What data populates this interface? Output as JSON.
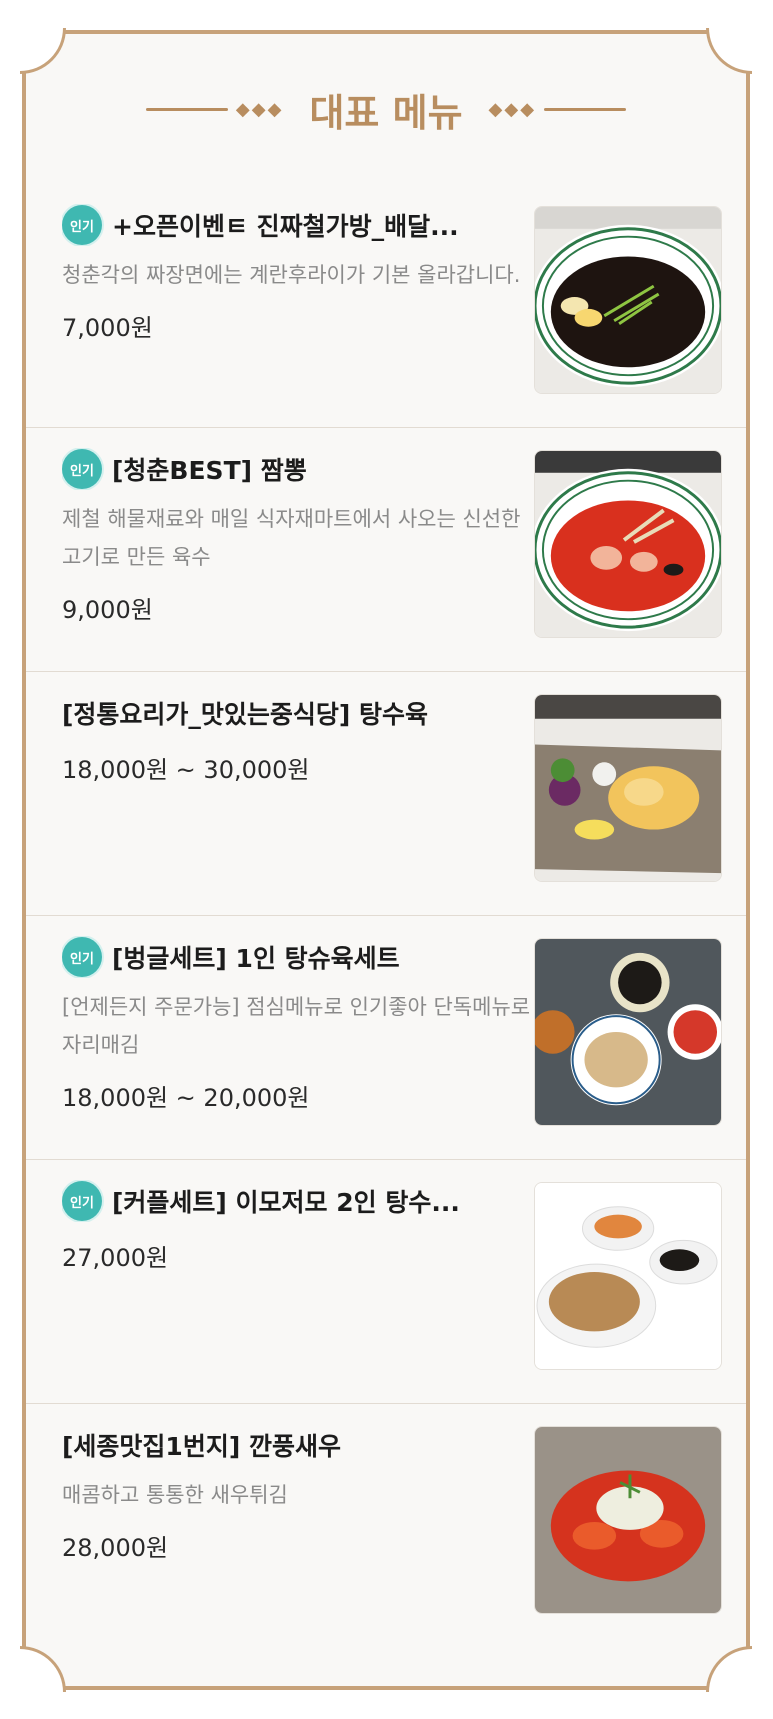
{
  "header": {
    "title": "대표 메뉴",
    "diamonds": "◆◆◆"
  },
  "menu": [
    {
      "badge": "인기",
      "name": "+오픈이벤ㅌ 진짜철가방_배달...",
      "description": "청춘각의 짜장면에는 계란후라이가 기본 올라갑니다.",
      "price": "7,000원",
      "photo_icon": "jjajangmyeon-photo"
    },
    {
      "badge": "인기",
      "name": "[청춘BEST] 짬뽕",
      "description": "제철 해물재료와 매일 식자재마트에서 사오는 신선한 고기로 만든 육수",
      "price": "9,000원",
      "photo_icon": "jjamppong-photo"
    },
    {
      "badge": "",
      "name": "[정통요리가_맛있는중식당] 탕수육",
      "description": "",
      "price": "18,000원 ~ 30,000원",
      "photo_icon": "tangsuyuk-photo"
    },
    {
      "badge": "인기",
      "name": "[벙글세트] 1인 탕슈육세트",
      "description": "[언제든지 주문가능] 점심메뉴로 인기좋아 단독메뉴로 자리매김",
      "price": "18,000원 ~ 20,000원",
      "photo_icon": "set-meal-photo"
    },
    {
      "badge": "인기",
      "name": "[커플세트] 이모저모 2인  탕수...",
      "description": "",
      "price": "27,000원",
      "photo_icon": "couple-set-photo"
    },
    {
      "badge": "",
      "name": "[세종맛집1번지] 깐풍새우",
      "description": "매콤하고 통통한 새우튀김",
      "price": "28,000원",
      "photo_icon": "kkanpung-shrimp-photo"
    }
  ],
  "colors": {
    "accent": "#b88d5f",
    "badge": "#3fb8b1",
    "frame": "#c7a27a"
  }
}
